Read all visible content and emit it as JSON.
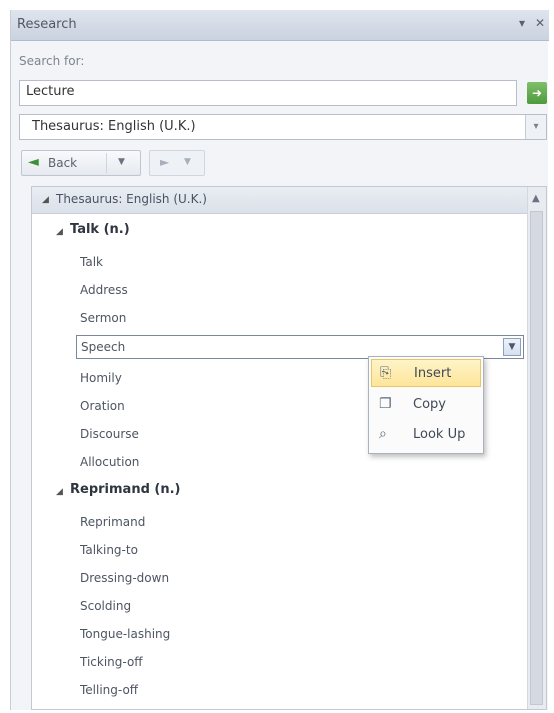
{
  "pane": {
    "title": "Research",
    "pin_icon": "pin-icon",
    "close_icon": "close-icon"
  },
  "search": {
    "label": "Search for:",
    "value": "Lecture",
    "go_icon": "arrow-right-icon"
  },
  "source": {
    "selected": "Thesaurus: English (U.K.)"
  },
  "nav": {
    "back_label": "Back"
  },
  "results": {
    "header": "Thesaurus: English (U.K.)",
    "groups": [
      {
        "head": "Talk (n.)",
        "items": [
          "Talk",
          "Address",
          "Sermon",
          "Speech",
          "Homily",
          "Oration",
          "Discourse",
          "Allocution"
        ]
      },
      {
        "head": "Reprimand (n.)",
        "items": [
          "Reprimand",
          "Talking-to",
          "Dressing-down",
          "Scolding",
          "Tongue-lashing",
          "Ticking-off",
          "Telling-off"
        ]
      }
    ]
  },
  "context_menu": {
    "items": [
      {
        "label": "Insert",
        "icon": "insert-icon",
        "highlighted": true
      },
      {
        "label": "Copy",
        "icon": "copy-icon",
        "highlighted": false
      },
      {
        "label": "Look Up",
        "icon": "lookup-icon",
        "highlighted": false
      }
    ]
  }
}
